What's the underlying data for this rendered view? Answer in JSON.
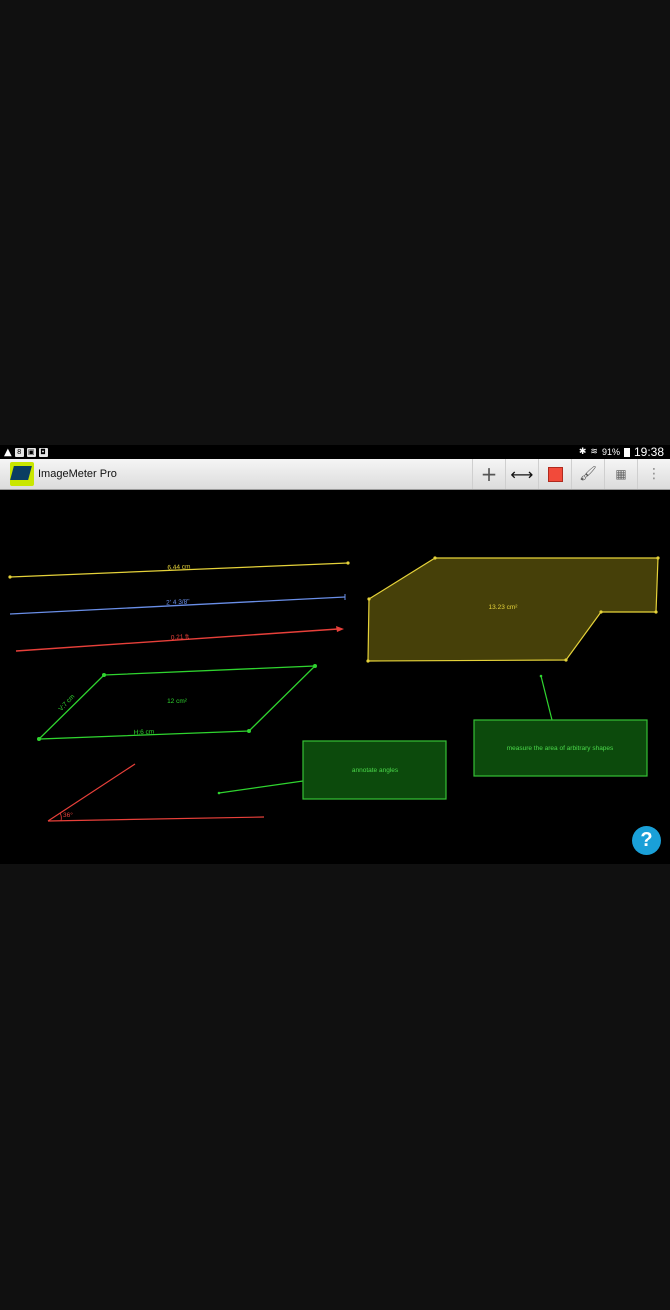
{
  "status_bar": {
    "left_icons": [
      "warning-icon",
      "notification-icon",
      "gallery-icon",
      "screenshot-icon"
    ],
    "battery": "91%",
    "time": "19:38"
  },
  "app_bar": {
    "title": "ImageMeter Pro",
    "actions": [
      "plus-icon",
      "double-arrow-icon",
      "color-swatch",
      "brush-icon",
      "calculator-icon",
      "more-icon"
    ],
    "active_color": "#f24a3a"
  },
  "canvas": {
    "lines": {
      "yellow": "6.44 cm",
      "blue": "2' 4 3/8\"",
      "red": "0.21 ft"
    },
    "parallelogram": {
      "area": "12 cm²",
      "side": "V:7 cm",
      "base": "H:6 cm"
    },
    "angle": "36°",
    "polygon": {
      "area": "13.23 cm²"
    },
    "notes": {
      "shapes": "measure the area of arbitrary shapes",
      "angles": "annotate angles"
    },
    "colors": {
      "yellow": "#e5d23a",
      "blue": "#6a8fe8",
      "red": "#e8403a",
      "green": "#2fd42f",
      "polygon_fill": "#4a430a",
      "note_fill": "#0c4a0c",
      "note_border": "#35c035"
    }
  },
  "help_button": {
    "label": "?"
  }
}
